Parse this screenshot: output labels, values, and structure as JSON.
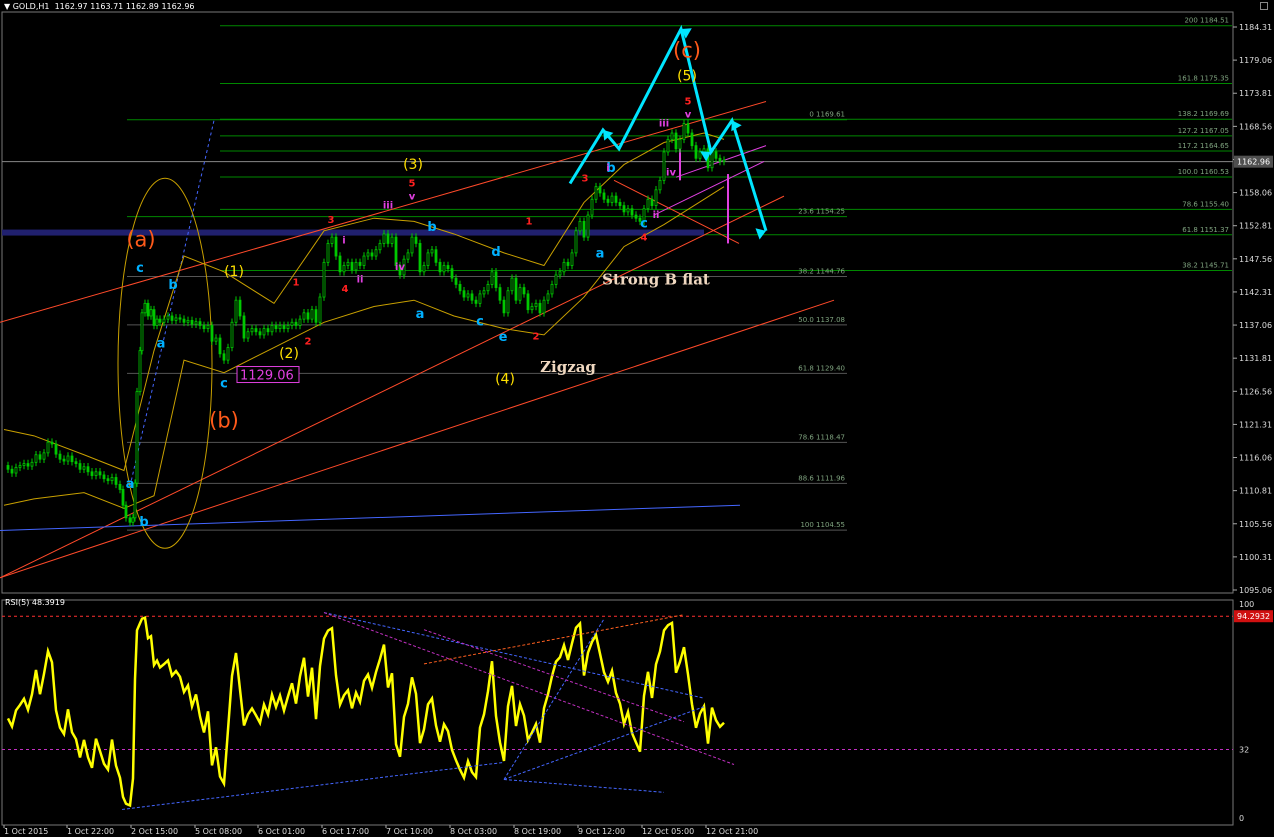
{
  "header": {
    "symbol_arrow": "▼",
    "symbol": "GOLD,H1",
    "ohlc": "1162.97 1163.71 1162.89 1162.96"
  },
  "colors": {
    "background": "#000000",
    "bull": "#00c800",
    "grid_line": "#008800",
    "fib_text": "#7fa37f",
    "trend": "#ff4a2a",
    "blue_line": "#4466ff",
    "band": "#c8a000",
    "arrow": "#00e5ff",
    "rsi_line": "#ffff00",
    "rsi_levels": "#ff3030",
    "current_price_bg": "#505050"
  },
  "chart_data": [
    {
      "type": "candlestick",
      "title": "",
      "symbol": "GOLD",
      "timeframe": "H1",
      "yaxis": {
        "min": 1095.06,
        "max": 1184.31,
        "ticks": [
          "1184.31",
          "1179.06",
          "1173.81",
          "1168.56",
          "1163.31",
          "1158.06",
          "1152.81",
          "1147.56",
          "1142.31",
          "1137.06",
          "1131.81",
          "1126.56",
          "1121.31",
          "1116.06",
          "1110.81",
          "1105.56",
          "1100.31",
          "1095.06"
        ]
      },
      "xaxis": {
        "ticks": [
          "1 Oct 2015",
          "1 Oct 22:00",
          "2 Oct 15:00",
          "5 Oct 08:00",
          "6 Oct 01:00",
          "6 Oct 17:00",
          "7 Oct 10:00",
          "8 Oct 03:00",
          "8 Oct 19:00",
          "9 Oct 12:00",
          "12 Oct 05:00",
          "12 Oct 21:00"
        ]
      },
      "current_price": "1162.96",
      "price_path": [
        [
          0,
          1114.8
        ],
        [
          4,
          1114.2
        ],
        [
          8,
          1113.6
        ],
        [
          12,
          1114.5
        ],
        [
          16,
          1114.8
        ],
        [
          20,
          1115.1
        ],
        [
          24,
          1114.7
        ],
        [
          28,
          1115.3
        ],
        [
          32,
          1116.5
        ],
        [
          36,
          1115.8
        ],
        [
          40,
          1116.8
        ],
        [
          44,
          1118.5
        ],
        [
          48,
          1118.2
        ],
        [
          52,
          1116.6
        ],
        [
          56,
          1115.8
        ],
        [
          60,
          1115.5
        ],
        [
          64,
          1116.3
        ],
        [
          68,
          1115.4
        ],
        [
          72,
          1115.1
        ],
        [
          76,
          1114.2
        ],
        [
          80,
          1114.6
        ],
        [
          84,
          1113.8
        ],
        [
          88,
          1113.2
        ],
        [
          92,
          1113.8
        ],
        [
          96,
          1113.3
        ],
        [
          100,
          1112.7
        ],
        [
          104,
          1112.4
        ],
        [
          108,
          1112.9
        ],
        [
          112,
          1111.8
        ],
        [
          116,
          1111.0
        ],
        [
          119,
          1108.5
        ],
        [
          122,
          1106.5
        ],
        [
          126,
          1105.8
        ],
        [
          129,
          1106.5
        ],
        [
          131,
          1112.0
        ],
        [
          133,
          1126.5
        ],
        [
          136,
          1133.0
        ],
        [
          138,
          1139.0
        ],
        [
          141,
          1140.5
        ],
        [
          144,
          1138.5
        ],
        [
          147,
          1139.5
        ],
        [
          150,
          1137.0
        ],
        [
          153,
          1138.0
        ],
        [
          156,
          1137.5
        ],
        [
          160,
          1138.0
        ],
        [
          164,
          1138.5
        ],
        [
          168,
          1137.8
        ],
        [
          172,
          1138.2
        ],
        [
          176,
          1138.0
        ],
        [
          180,
          1137.5
        ],
        [
          184,
          1137.8
        ],
        [
          188,
          1137.2
        ],
        [
          192,
          1137.6
        ],
        [
          196,
          1137.0
        ],
        [
          200,
          1136.5
        ],
        [
          204,
          1137.0
        ],
        [
          208,
          1134.5
        ],
        [
          212,
          1135.0
        ],
        [
          216,
          1132.5
        ],
        [
          220,
          1131.5
        ],
        [
          224,
          1133.5
        ],
        [
          228,
          1137.5
        ],
        [
          232,
          1141.0
        ],
        [
          236,
          1138.5
        ],
        [
          240,
          1135.0
        ],
        [
          244,
          1136.0
        ],
        [
          248,
          1136.5
        ],
        [
          252,
          1136.0
        ],
        [
          256,
          1135.5
        ],
        [
          260,
          1136.5
        ],
        [
          264,
          1136.0
        ],
        [
          268,
          1137.0
        ],
        [
          272,
          1136.5
        ],
        [
          276,
          1137.0
        ],
        [
          280,
          1136.5
        ],
        [
          284,
          1137.0
        ],
        [
          288,
          1137.5
        ],
        [
          292,
          1137.0
        ],
        [
          296,
          1138.0
        ],
        [
          300,
          1139.0
        ],
        [
          304,
          1138.0
        ],
        [
          308,
          1139.5
        ],
        [
          312,
          1137.5
        ],
        [
          316,
          1141.5
        ],
        [
          320,
          1147.0
        ],
        [
          324,
          1150.0
        ],
        [
          328,
          1151.0
        ],
        [
          332,
          1148.0
        ],
        [
          336,
          1145.5
        ],
        [
          340,
          1146.5
        ],
        [
          344,
          1147.0
        ],
        [
          348,
          1145.8
        ],
        [
          352,
          1147.0
        ],
        [
          356,
          1146.5
        ],
        [
          360,
          1148.0
        ],
        [
          364,
          1148.5
        ],
        [
          368,
          1148.0
        ],
        [
          372,
          1149.0
        ],
        [
          376,
          1150.0
        ],
        [
          380,
          1151.5
        ],
        [
          384,
          1150.0
        ],
        [
          388,
          1151.0
        ],
        [
          392,
          1146.5
        ],
        [
          396,
          1145.0
        ],
        [
          400,
          1147.5
        ],
        [
          404,
          1148.5
        ],
        [
          408,
          1151.0
        ],
        [
          412,
          1150.0
        ],
        [
          416,
          1145.5
        ],
        [
          420,
          1146.5
        ],
        [
          424,
          1148.5
        ],
        [
          428,
          1149.0
        ],
        [
          432,
          1147.0
        ],
        [
          436,
          1145.5
        ],
        [
          440,
          1146.5
        ],
        [
          444,
          1146.0
        ],
        [
          448,
          1144.5
        ],
        [
          452,
          1143.5
        ],
        [
          456,
          1142.5
        ],
        [
          460,
          1141.5
        ],
        [
          464,
          1142.0
        ],
        [
          468,
          1141.0
        ],
        [
          472,
          1140.5
        ],
        [
          476,
          1142.0
        ],
        [
          480,
          1142.5
        ],
        [
          484,
          1143.5
        ],
        [
          488,
          1145.5
        ],
        [
          492,
          1143.0
        ],
        [
          496,
          1141.0
        ],
        [
          500,
          1139.0
        ],
        [
          504,
          1142.5
        ],
        [
          508,
          1144.5
        ],
        [
          512,
          1141.0
        ],
        [
          516,
          1143.0
        ],
        [
          520,
          1142.0
        ],
        [
          524,
          1139.5
        ],
        [
          528,
          1140.0
        ],
        [
          532,
          1140.5
        ],
        [
          536,
          1139.0
        ],
        [
          540,
          1141.0
        ],
        [
          544,
          1142.0
        ],
        [
          548,
          1143.5
        ],
        [
          552,
          1145.0
        ],
        [
          556,
          1145.5
        ],
        [
          560,
          1147.0
        ],
        [
          564,
          1146.5
        ],
        [
          568,
          1148.5
        ],
        [
          572,
          1152.0
        ],
        [
          576,
          1153.5
        ],
        [
          580,
          1151.0
        ],
        [
          584,
          1154.5
        ],
        [
          588,
          1157.0
        ],
        [
          592,
          1159.0
        ],
        [
          596,
          1158.0
        ],
        [
          600,
          1157.0
        ],
        [
          604,
          1156.5
        ],
        [
          608,
          1157.5
        ],
        [
          612,
          1156.5
        ],
        [
          616,
          1156.0
        ],
        [
          620,
          1155.0
        ],
        [
          624,
          1155.5
        ],
        [
          628,
          1154.5
        ],
        [
          632,
          1154.0
        ],
        [
          636,
          1153.5
        ],
        [
          640,
          1155.5
        ],
        [
          644,
          1157.0
        ],
        [
          648,
          1156.0
        ],
        [
          652,
          1158.5
        ],
        [
          656,
          1160.0
        ],
        [
          660,
          1164.5
        ],
        [
          664,
          1166.5
        ],
        [
          668,
          1167.5
        ],
        [
          672,
          1165.0
        ],
        [
          676,
          1166.5
        ],
        [
          680,
          1169.0
        ],
        [
          684,
          1167.5
        ],
        [
          688,
          1165.5
        ],
        [
          692,
          1163.5
        ],
        [
          696,
          1164.5
        ],
        [
          700,
          1165.0
        ],
        [
          704,
          1162.0
        ],
        [
          708,
          1164.5
        ],
        [
          712,
          1163.5
        ],
        [
          716,
          1163.0
        ],
        [
          720,
          1163.2
        ]
      ],
      "fibonacci_levels": [
        {
          "label": "200 1184.51",
          "value": 1184.51
        },
        {
          "label": "161.8 1175.35",
          "value": 1175.35
        },
        {
          "label": "138.2 1169.69",
          "value": 1169.69
        },
        {
          "label": "127.2 1167.05",
          "value": 1167.05
        },
        {
          "label": "117.2 1164.65",
          "value": 1164.65
        },
        {
          "label": "100.0 1160.53",
          "value": 1160.53
        },
        {
          "label": "78.6 1155.40",
          "value": 1155.4
        },
        {
          "label": "61.8 1151.37",
          "value": 1151.37
        },
        {
          "label": "38.2 1145.71",
          "value": 1145.71
        },
        {
          "label": "0 1169.61",
          "value": 1169.61
        },
        {
          "label": "23.6 1154.25",
          "value": 1154.25
        },
        {
          "label": "38.2 1144.76",
          "value": 1144.76
        },
        {
          "label": "50.0 1137.08",
          "value": 1137.08
        },
        {
          "label": "61.8 1129.40",
          "value": 1129.4
        },
        {
          "label": "78.6 1118.47",
          "value": 1118.47
        },
        {
          "label": "88.6 1111.96",
          "value": 1111.96
        },
        {
          "label": "100 1104.55",
          "value": 1104.55
        }
      ],
      "price_box": "1129.06",
      "wave_labels": [
        {
          "text": "(a)",
          "color": "#ff5a1a",
          "size": "big",
          "t": 137,
          "p": 1149.5
        },
        {
          "text": "(b)",
          "color": "#ff5a1a",
          "size": "big",
          "t": 220,
          "p": 1120.8
        },
        {
          "text": "(c)",
          "color": "#ff5a1a",
          "size": "big",
          "t": 683,
          "p": 1179.5
        },
        {
          "text": "(1)",
          "color": "#ffe000",
          "size": "mid",
          "t": 230,
          "p": 1144.8
        },
        {
          "text": "(2)",
          "color": "#ffe000",
          "size": "mid",
          "t": 285,
          "p": 1131.8
        },
        {
          "text": "(3)",
          "color": "#ffe000",
          "size": "mid",
          "t": 409,
          "p": 1161.8
        },
        {
          "text": "(4)",
          "color": "#ffe000",
          "size": "mid",
          "t": 501,
          "p": 1127.8
        },
        {
          "text": "(5)",
          "color": "#ffe000",
          "size": "mid",
          "t": 683,
          "p": 1175.8
        },
        {
          "text": "c",
          "color": "#00b0ff",
          "size": "small",
          "t": 136,
          "p": 1145.5
        },
        {
          "text": "b",
          "color": "#00b0ff",
          "size": "small",
          "t": 169,
          "p": 1142.8
        },
        {
          "text": "a",
          "color": "#00b0ff",
          "size": "small",
          "t": 157,
          "p": 1133.5
        },
        {
          "text": "a",
          "color": "#00b0ff",
          "size": "small",
          "t": 126,
          "p": 1111.2
        },
        {
          "text": "b",
          "color": "#00b0ff",
          "size": "small",
          "t": 140,
          "p": 1105.2
        },
        {
          "text": "c",
          "color": "#00b0ff",
          "size": "small",
          "t": 220,
          "p": 1127.2
        },
        {
          "text": "a",
          "color": "#00b0ff",
          "size": "small",
          "t": 416,
          "p": 1138.2
        },
        {
          "text": "b",
          "color": "#00b0ff",
          "size": "small",
          "t": 428,
          "p": 1152.0
        },
        {
          "text": "c",
          "color": "#00b0ff",
          "size": "small",
          "t": 476,
          "p": 1137.0
        },
        {
          "text": "d",
          "color": "#00b0ff",
          "size": "small",
          "t": 492,
          "p": 1148.0
        },
        {
          "text": "e",
          "color": "#00b0ff",
          "size": "small",
          "t": 499,
          "p": 1134.5
        },
        {
          "text": "a",
          "color": "#00b0ff",
          "size": "small",
          "t": 596,
          "p": 1147.8
        },
        {
          "text": "b",
          "color": "#00b0ff",
          "size": "small",
          "t": 607,
          "p": 1161.3
        },
        {
          "text": "c",
          "color": "#00b0ff",
          "size": "small",
          "t": 640,
          "p": 1152.5
        },
        {
          "text": "1",
          "color": "#ff2020",
          "size": "tiny",
          "t": 292,
          "p": 1143.3
        },
        {
          "text": "2",
          "color": "#ff2020",
          "size": "tiny",
          "t": 304,
          "p": 1134.0
        },
        {
          "text": "3",
          "color": "#ff2020",
          "size": "tiny",
          "t": 327,
          "p": 1153.2
        },
        {
          "text": "4",
          "color": "#ff2020",
          "size": "tiny",
          "t": 341,
          "p": 1142.3
        },
        {
          "text": "5",
          "color": "#ff2020",
          "size": "tiny",
          "t": 408,
          "p": 1159.0
        },
        {
          "text": "1",
          "color": "#ff2020",
          "size": "tiny",
          "t": 525,
          "p": 1153.0
        },
        {
          "text": "2",
          "color": "#ff2020",
          "size": "tiny",
          "t": 532,
          "p": 1134.8
        },
        {
          "text": "3",
          "color": "#ff2020",
          "size": "tiny",
          "t": 581,
          "p": 1159.8
        },
        {
          "text": "4",
          "color": "#ff2020",
          "size": "tiny",
          "t": 640,
          "p": 1150.5
        },
        {
          "text": "5",
          "color": "#ff2020",
          "size": "tiny",
          "t": 684,
          "p": 1172.0
        },
        {
          "text": "i",
          "color": "#e040e0",
          "size": "tiny",
          "t": 340,
          "p": 1150.0
        },
        {
          "text": "ii",
          "color": "#e040e0",
          "size": "tiny",
          "t": 356,
          "p": 1143.8
        },
        {
          "text": "iii",
          "color": "#e040e0",
          "size": "tiny",
          "t": 384,
          "p": 1155.5
        },
        {
          "text": "iv",
          "color": "#e040e0",
          "size": "tiny",
          "t": 396,
          "p": 1145.8
        },
        {
          "text": "v",
          "color": "#e040e0",
          "size": "tiny",
          "t": 408,
          "p": 1157.0
        },
        {
          "text": "i",
          "color": "#e040e0",
          "size": "tiny",
          "t": 604,
          "p": 1161.5
        },
        {
          "text": "ii",
          "color": "#e040e0",
          "size": "tiny",
          "t": 652,
          "p": 1154.0
        },
        {
          "text": "iii",
          "color": "#e040e0",
          "size": "tiny",
          "t": 660,
          "p": 1168.5
        },
        {
          "text": "iv",
          "color": "#e040e0",
          "size": "tiny",
          "t": 667,
          "p": 1160.8
        },
        {
          "text": "v",
          "color": "#e040e0",
          "size": "tiny",
          "t": 684,
          "p": 1170.0
        }
      ],
      "annotations": [
        {
          "text": "Strong B flat",
          "t": 652,
          "p": 1143.5
        },
        {
          "text": "Zigzag",
          "t": 564,
          "p": 1129.6
        }
      ]
    },
    {
      "type": "line",
      "title": "RSI(5) 48.3919",
      "series_label": "RSI(5)",
      "current_value": "48.3919",
      "yaxis_ticks": [
        "100",
        "32",
        "0"
      ],
      "overbought_label": "94.2932",
      "overbought": 94.2932,
      "oversold": 32,
      "ylim": [
        0,
        100
      ]
    }
  ]
}
